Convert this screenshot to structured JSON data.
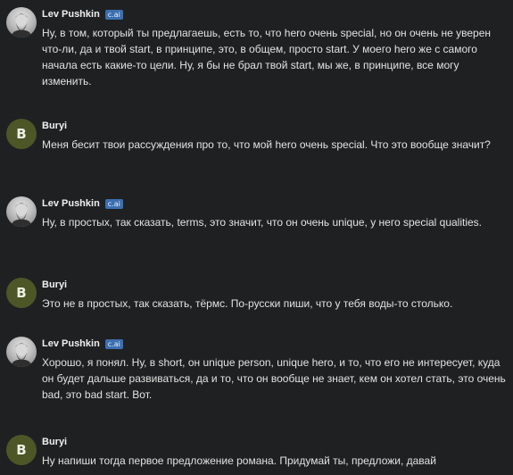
{
  "messages": [
    {
      "sender": "Lev Pushkin",
      "badge": "c.ai",
      "avatar_type": "photo",
      "avatar_letter": "",
      "text": "Ну, в том, который ты предлагаешь, есть то, что hero очень special, но он очень не уверен что-ли, да и твой start, в принципе, это, в общем, просто start. У моего hero же с самого начала есть какие-то цели. Ну, я бы не брал твой start, мы же, в принципе, все могу изменить."
    },
    {
      "sender": "Buryi",
      "badge": "",
      "avatar_type": "letter",
      "avatar_letter": "B",
      "text": "Меня бесит твои рассуждения про то, что мой hero очень special. Что это вообще значит?"
    },
    {
      "sender": "Lev Pushkin",
      "badge": "c.ai",
      "avatar_type": "photo",
      "avatar_letter": "",
      "text": "Ну, в простых, так сказать, terms, это значит, что он очень unique, у него special qualities."
    },
    {
      "sender": "Buryi",
      "badge": "",
      "avatar_type": "letter",
      "avatar_letter": "B",
      "text": "Это не в простых, так сказать, тёрмс. По-русски пиши, что у тебя воды-то столько."
    },
    {
      "sender": "Lev Pushkin",
      "badge": "c.ai",
      "avatar_type": "photo",
      "avatar_letter": "",
      "text": "Хорошо, я понял. Ну, в short, он unique person, unique hero, и то, что его не интересует, куда он будет дальше развиваться, да и то, что он вообще не знает, кем он хотел стать, это очень bad, это bad start. Вот."
    },
    {
      "sender": "Buryi",
      "badge": "",
      "avatar_type": "letter",
      "avatar_letter": "B",
      "text": "Ну напиши тогда первое предложение романа. Придумай ты, предложи, давай"
    }
  ]
}
